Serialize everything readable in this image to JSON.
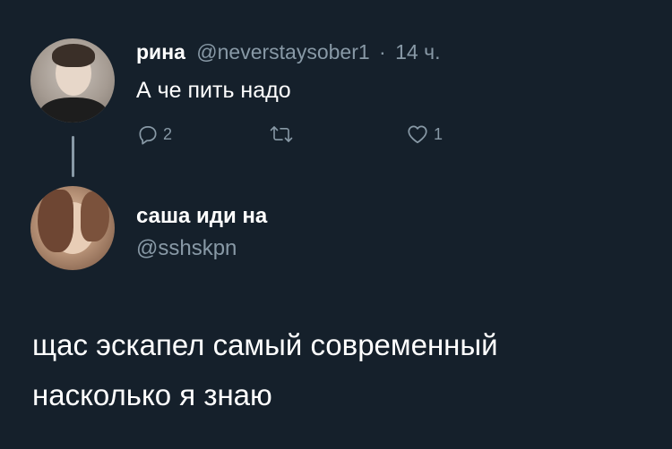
{
  "parent_tweet": {
    "display_name": "рина",
    "handle": "@neverstaysober1",
    "separator": "·",
    "timestamp": "14 ч.",
    "text": "А че пить надо",
    "actions": {
      "reply_count": "2",
      "retweet_count": "",
      "like_count": "1"
    }
  },
  "reply_tweet": {
    "display_name": "саша иди на",
    "handle": "@sshskpn",
    "text_line_1": "щас эскапел самый современный",
    "text_line_2": "насколько я знаю"
  },
  "colors": {
    "background": "#15202b",
    "primary_text": "#ffffff",
    "secondary_text": "#8899a6"
  },
  "icons": {
    "reply": "reply-icon",
    "retweet": "retweet-icon",
    "like": "heart-icon"
  }
}
